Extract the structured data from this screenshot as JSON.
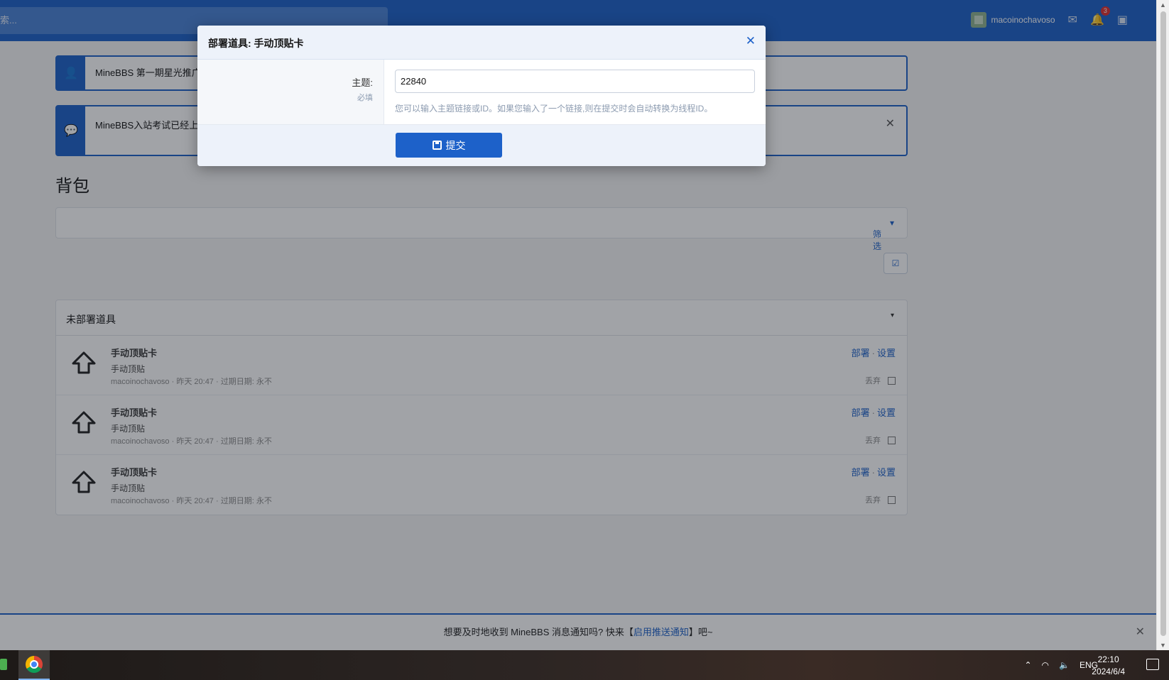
{
  "header": {
    "search_placeholder": "索...",
    "username": "macoinochavoso",
    "notification_count": "3"
  },
  "notices": [
    {
      "text": "MineBBS 第一期星光推广"
    },
    {
      "text": "MineBBS入站考试已经上线"
    }
  ],
  "page_title": "背包",
  "filter_label": "筛选",
  "section": {
    "title": "未部署道具",
    "items": [
      {
        "name": "手动顶贴卡",
        "desc": "手动顶贴",
        "user": "macoinochavoso",
        "time": "昨天 20:47",
        "expiry_label": "过期日期:",
        "expiry": "永不",
        "deploy": "部署",
        "settings": "设置",
        "discard": "丢弃"
      },
      {
        "name": "手动顶贴卡",
        "desc": "手动顶贴",
        "user": "macoinochavoso",
        "time": "昨天 20:47",
        "expiry_label": "过期日期:",
        "expiry": "永不",
        "deploy": "部署",
        "settings": "设置",
        "discard": "丢弃"
      },
      {
        "name": "手动顶贴卡",
        "desc": "手动顶贴",
        "user": "macoinochavoso",
        "time": "昨天 20:47",
        "expiry_label": "过期日期:",
        "expiry": "永不",
        "deploy": "部署",
        "settings": "设置",
        "discard": "丢弃"
      }
    ]
  },
  "push_bar": {
    "prefix": "想要及时地收到 MineBBS 消息通知吗? 快来【",
    "link": "启用推送通知",
    "suffix": "】吧~"
  },
  "modal": {
    "title": "部署道具: 手动顶贴卡",
    "field_label": "主题:",
    "required": "必填",
    "value": "22840",
    "hint": "您可以输入主题链接或ID。如果您输入了一个链接,则在提交时会自动转换为线程ID。",
    "submit": "提交"
  },
  "taskbar": {
    "lang": "ENG",
    "time": "22:10",
    "date": "2024/6/4"
  },
  "colors": {
    "brand": "#1d61c9",
    "overlay": "rgba(20,25,35,0.40)"
  }
}
